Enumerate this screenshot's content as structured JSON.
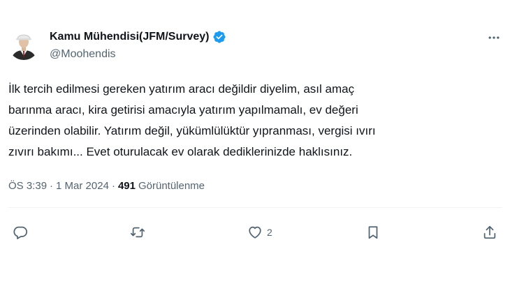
{
  "author": {
    "display_name": "Kamu Mühendisi(JFM/Survey)",
    "handle": "@Moohendis",
    "verified": true
  },
  "tweet": {
    "lines": [
      "İlk tercih edilmesi gereken yatırım aracı değildir diyelim, asıl amaç",
      "barınma aracı, kira getirisi amacıyla yatırım yapılmamalı, ev değeri",
      "üzerinden olabilir. Yatırım değil, yükümlülüktür yıpranması, vergisi ıvırı",
      "zıvırı bakımı... Evet oturulacak ev olarak dediklerinizde haklısınız."
    ]
  },
  "meta": {
    "time": "ÖS 3:39",
    "separator": "·",
    "date": "1 Mar 2024",
    "separator2": "·",
    "views_count": "491",
    "views_label": "Görüntülenme"
  },
  "actions": {
    "reply_count": "",
    "retweet_count": "",
    "like_count": "2",
    "bookmark_count": ""
  },
  "colors": {
    "text": "#0f1419",
    "secondary": "#536471",
    "verified": "#1d9bf0",
    "divider": "#eff3f4"
  },
  "icons": [
    "more-icon",
    "verified-badge-icon",
    "reply-icon",
    "retweet-icon",
    "like-icon",
    "bookmark-icon",
    "share-icon"
  ]
}
